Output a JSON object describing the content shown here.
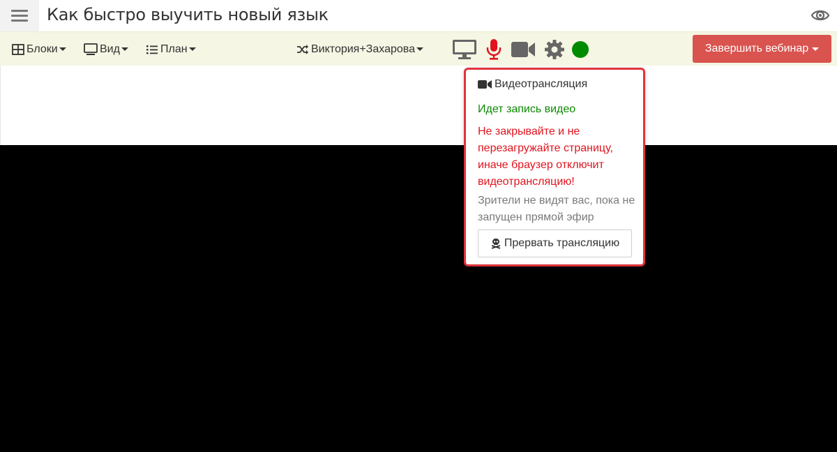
{
  "header": {
    "title": "Как быстро выучить новый язык"
  },
  "toolbar": {
    "blocks_label": "Блоки",
    "view_label": "Вид",
    "plan_label": "План",
    "presenter_label": "Виктория+Захарова",
    "end_button_label": "Завершить вебинар",
    "status_color": "#008a00",
    "mic_color": "#e0141e"
  },
  "popover": {
    "title": "Видеотрансляция",
    "recording_status": "Идет запись видео",
    "warning": "Не закрывайте и не перезагружайте страницу, иначе браузер отключит видеотрансляцию!",
    "note": "Зрители не видят вас, пока не запущен прямой эфир",
    "stop_button_label": "Прервать трансляцию"
  },
  "icons": [
    "menu-icon",
    "eye-icon",
    "grid-icon",
    "monitor-icon",
    "list-icon",
    "shuffle-icon",
    "screen-share-icon",
    "microphone-icon",
    "camera-icon",
    "gear-icon",
    "status-dot",
    "video-camera-icon",
    "skull-icon"
  ]
}
